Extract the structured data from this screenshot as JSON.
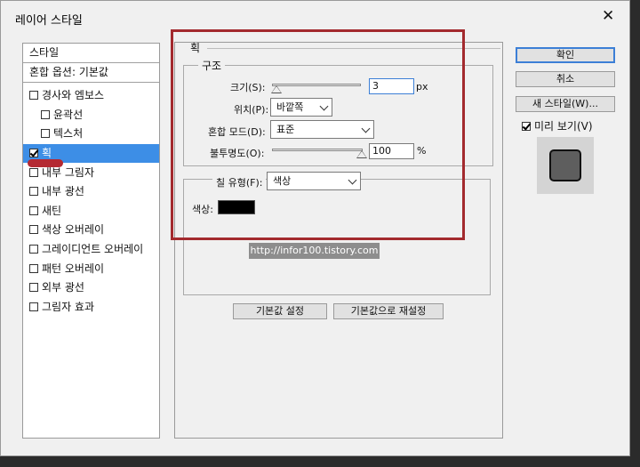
{
  "window": {
    "title": "레이어 스타일",
    "close": "✕"
  },
  "sidebar": {
    "items": [
      {
        "label": "스타일",
        "checkbox": false
      },
      {
        "label": "혼합 옵션: 기본값",
        "checkbox": false
      },
      {
        "label": "경사와 엠보스",
        "checkbox": true,
        "checked": false
      },
      {
        "label": "윤곽선",
        "checkbox": true,
        "checked": false
      },
      {
        "label": "텍스처",
        "checkbox": true,
        "checked": false
      },
      {
        "label": "획",
        "checkbox": true,
        "checked": true
      },
      {
        "label": "내부 그림자",
        "checkbox": true,
        "checked": false
      },
      {
        "label": "내부 광선",
        "checkbox": true,
        "checked": false
      },
      {
        "label": "새틴",
        "checkbox": true,
        "checked": false
      },
      {
        "label": "색상 오버레이",
        "checkbox": true,
        "checked": false
      },
      {
        "label": "그레이디언트 오버레이",
        "checkbox": true,
        "checked": false
      },
      {
        "label": "패턴 오버레이",
        "checkbox": true,
        "checked": false
      },
      {
        "label": "외부 광선",
        "checkbox": true,
        "checked": false
      },
      {
        "label": "그림자 효과",
        "checkbox": true,
        "checked": false
      }
    ]
  },
  "stroke": {
    "section_title": "획",
    "structure": {
      "title": "구조",
      "size_label": "크기(S):",
      "size_value": "3",
      "size_unit": "px",
      "position_label": "위치(P):",
      "position_value": "바깥쪽",
      "blend_label": "혼합 모드(D):",
      "blend_value": "표준",
      "opacity_label": "불투명도(O):",
      "opacity_value": "100",
      "opacity_unit": "%"
    },
    "fill": {
      "type_label": "칠 유형(F):",
      "type_value": "색상",
      "color_label": "색상:",
      "color_hex": "#000000"
    },
    "make_default": "기본값 설정",
    "reset_default": "기본값으로 재설정"
  },
  "right": {
    "ok": "확인",
    "cancel": "취소",
    "new_style": "새 스타일(W)...",
    "preview_label": "미리 보기(V)",
    "preview_checked": true
  },
  "watermark": "http://infor100.tistory.com",
  "colors": {
    "highlight": "#3d8ee6",
    "annotation_red": "#a32a2e",
    "dialog_bg": "#f0f0f0"
  }
}
